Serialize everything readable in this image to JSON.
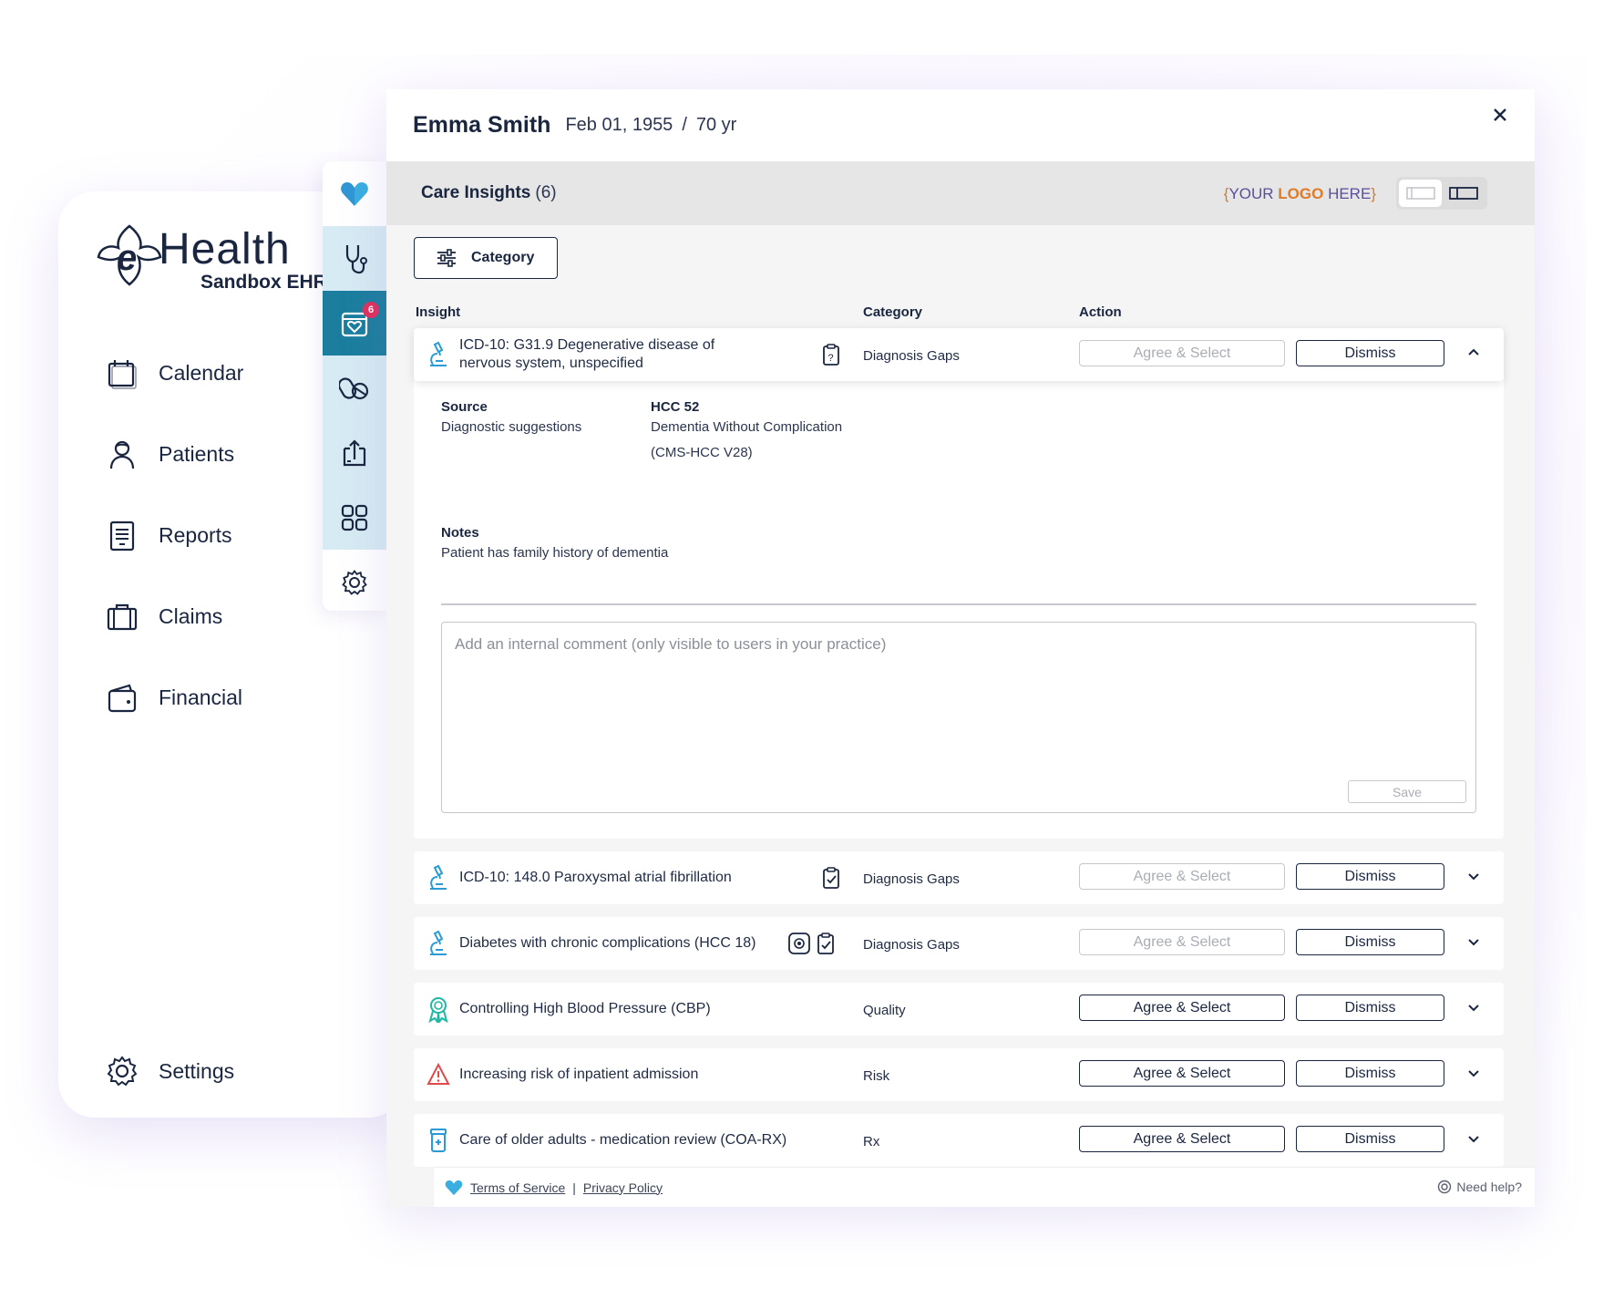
{
  "brand": {
    "name": "Health",
    "subtitle": "Sandbox EHR"
  },
  "nav": {
    "items": [
      {
        "label": "Calendar",
        "icon": "calendar-icon"
      },
      {
        "label": "Patients",
        "icon": "patient-icon"
      },
      {
        "label": "Reports",
        "icon": "report-icon"
      },
      {
        "label": "Claims",
        "icon": "briefcase-icon"
      },
      {
        "label": "Financial",
        "icon": "wallet-icon"
      }
    ],
    "settings_label": "Settings"
  },
  "rail": {
    "badge_count": "6"
  },
  "patient": {
    "name": "Emma Smith",
    "dob": "Feb 01, 1955",
    "separator": "/",
    "age": "70 yr"
  },
  "insights": {
    "title": "Care Insights",
    "count": "(6)",
    "logo_placeholder": {
      "open": "{",
      "your": "YOUR ",
      "logo": "LOGO",
      "here": " HERE",
      "close": "}"
    },
    "filter_label": "Category",
    "columns": {
      "insight": "Insight",
      "category": "Category",
      "action": "Action"
    },
    "agree_label": "Agree & Select",
    "dismiss_label": "Dismiss",
    "expanded": {
      "title": "ICD-10: G31.9 Degenerative disease of nervous system, unspecified",
      "category": "Diagnosis Gaps",
      "source_label": "Source",
      "source_value": "Diagnostic suggestions",
      "hcc_label": "HCC 52",
      "hcc_line1": "Dementia Without Complication",
      "hcc_line2": "(CMS-HCC V28)",
      "notes_label": "Notes",
      "notes_value": "Patient has family history of dementia",
      "comment_placeholder": "Add an internal comment (only visible to users in your practice)",
      "save_label": "Save"
    },
    "rows": [
      {
        "title": "ICD-10: 148.0 Paroxysmal atrial fibrillation",
        "category": "Diagnosis Gaps",
        "agree_enabled": false
      },
      {
        "title": "Diabetes with chronic complications (HCC 18)",
        "category": "Diagnosis Gaps",
        "agree_enabled": false
      },
      {
        "title": "Controlling High Blood Pressure (CBP)",
        "category": "Quality",
        "agree_enabled": true
      },
      {
        "title": "Increasing risk of inpatient admission",
        "category": "Risk",
        "agree_enabled": true
      },
      {
        "title": "Care of older adults - medication review (COA-RX)",
        "category": "Rx",
        "agree_enabled": true
      }
    ]
  },
  "footer": {
    "terms": "Terms of Service",
    "separator": "|",
    "privacy": "Privacy Policy",
    "help": "Need help?"
  },
  "colors": {
    "accent_teal": "#1b7e9e",
    "rail_tint": "#d6ebf3",
    "heart_blue": "#3aaee0",
    "badge_red": "#e0305c",
    "logo_orange": "#e07a26",
    "logo_purple": "#5b4e9c",
    "text_navy": "#1a2640"
  }
}
